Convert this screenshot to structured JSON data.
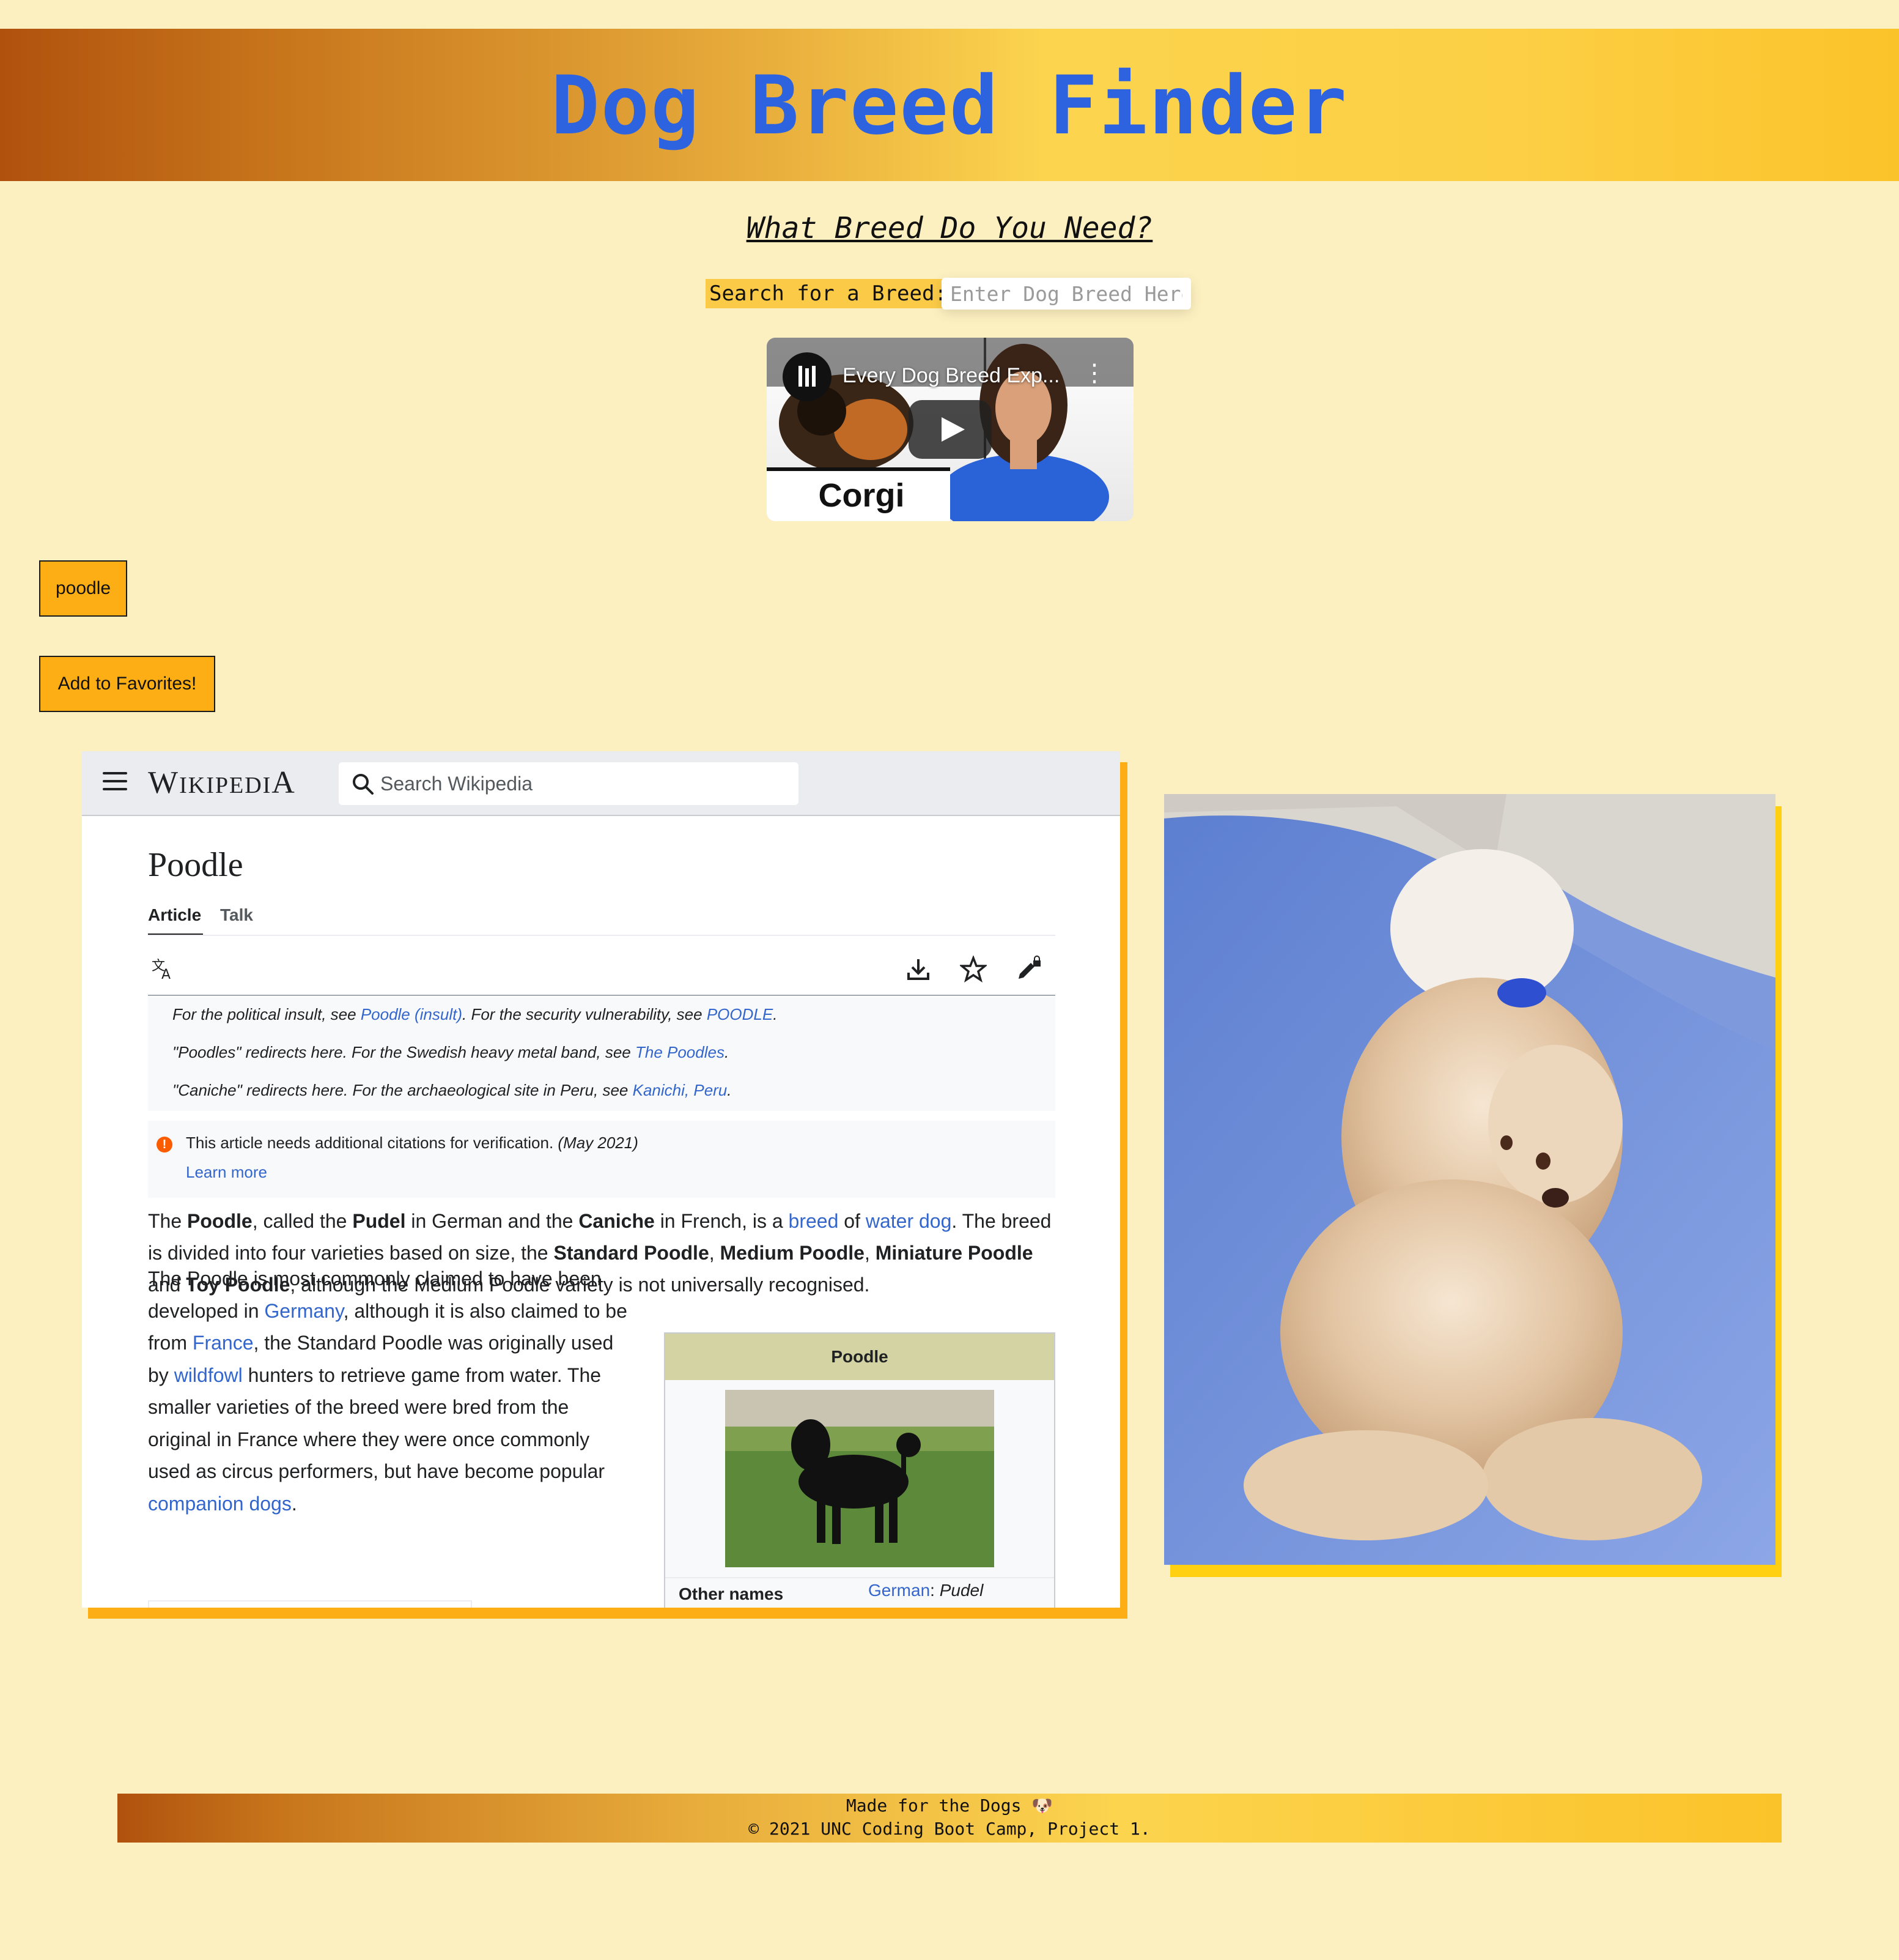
{
  "header": {
    "title": "Dog Breed Finder"
  },
  "main": {
    "subtitle": "What Breed Do You Need?",
    "search": {
      "label": "Search for a Breed:",
      "placeholder": "Enter Dog Breed Here"
    },
    "video": {
      "title": "Every Dog Breed Exp...",
      "caption": "Corgi"
    },
    "breed_button": "poodle",
    "favorites_button": "Add to Favorites!"
  },
  "wiki": {
    "logo": "Wikipedia",
    "search_placeholder": "Search Wikipedia",
    "page_title": "Poodle",
    "tabs": [
      "Article",
      "Talk"
    ],
    "hatnotes": [
      {
        "text": "For the political insult, see ",
        "link1": "Poodle (insult)",
        "mid": ". For the security vulnerability, see ",
        "link2": "POODLE",
        "end": "."
      },
      {
        "text": "\"Poodles\" redirects here. For the Swedish heavy metal band, see ",
        "link1": "The Poodles",
        "end": "."
      },
      {
        "text": "\"Caniche\" redirects here. For the archaeological site in Peru, see ",
        "link1": "Kanichi, Peru",
        "end": "."
      }
    ],
    "citation_notice": {
      "text": "This article needs additional citations for verification.",
      "date": "(May 2021)",
      "link": "Learn more"
    },
    "para1": {
      "t1": "The ",
      "b1": "Poodle",
      "t2": ", called the ",
      "b2": "Pudel",
      "t3": " in German and the ",
      "b3": "Caniche",
      "t4": " in French, is a ",
      "l1": "breed",
      "t5": " of ",
      "l2": "water dog",
      "t6": ". The breed is divided into four varieties based on size, the ",
      "b4": "Standard Poodle",
      "t7": ", ",
      "b5": "Medium Poodle",
      "t8": ", ",
      "b6": "Miniature Poodle",
      "t9": " and ",
      "b7": "Toy Poodle",
      "t10": ", although the Medium Poodle variety is not universally recognised."
    },
    "para2": {
      "t1": "The Poodle is most commonly claimed to have been developed in ",
      "l1": "Germany",
      "t2": ", although it is also claimed to be from ",
      "l2": "France",
      "t3": ", the Standard Poodle was originally used by ",
      "l3": "wildfowl",
      "t4": " hunters to retrieve game from water. The smaller varieties of the breed were bred from the original in France where they were once commonly used as circus performers, but have become popular ",
      "l4": "companion dogs",
      "t5": "."
    },
    "infobox": {
      "title": "Poodle",
      "row_label": "Other names",
      "row_value_link": "German",
      "row_value_text": "Pudel"
    }
  },
  "footer": {
    "line1": "Made for the Dogs 🐶",
    "line2": "© 2021 UNC Coding Boot Camp, Project 1."
  },
  "colors": {
    "background": "#fdf0c0",
    "title": "#2e63e0",
    "button": "#fcae14",
    "accent_shadow": "#ffd012",
    "link": "#3366cc"
  }
}
